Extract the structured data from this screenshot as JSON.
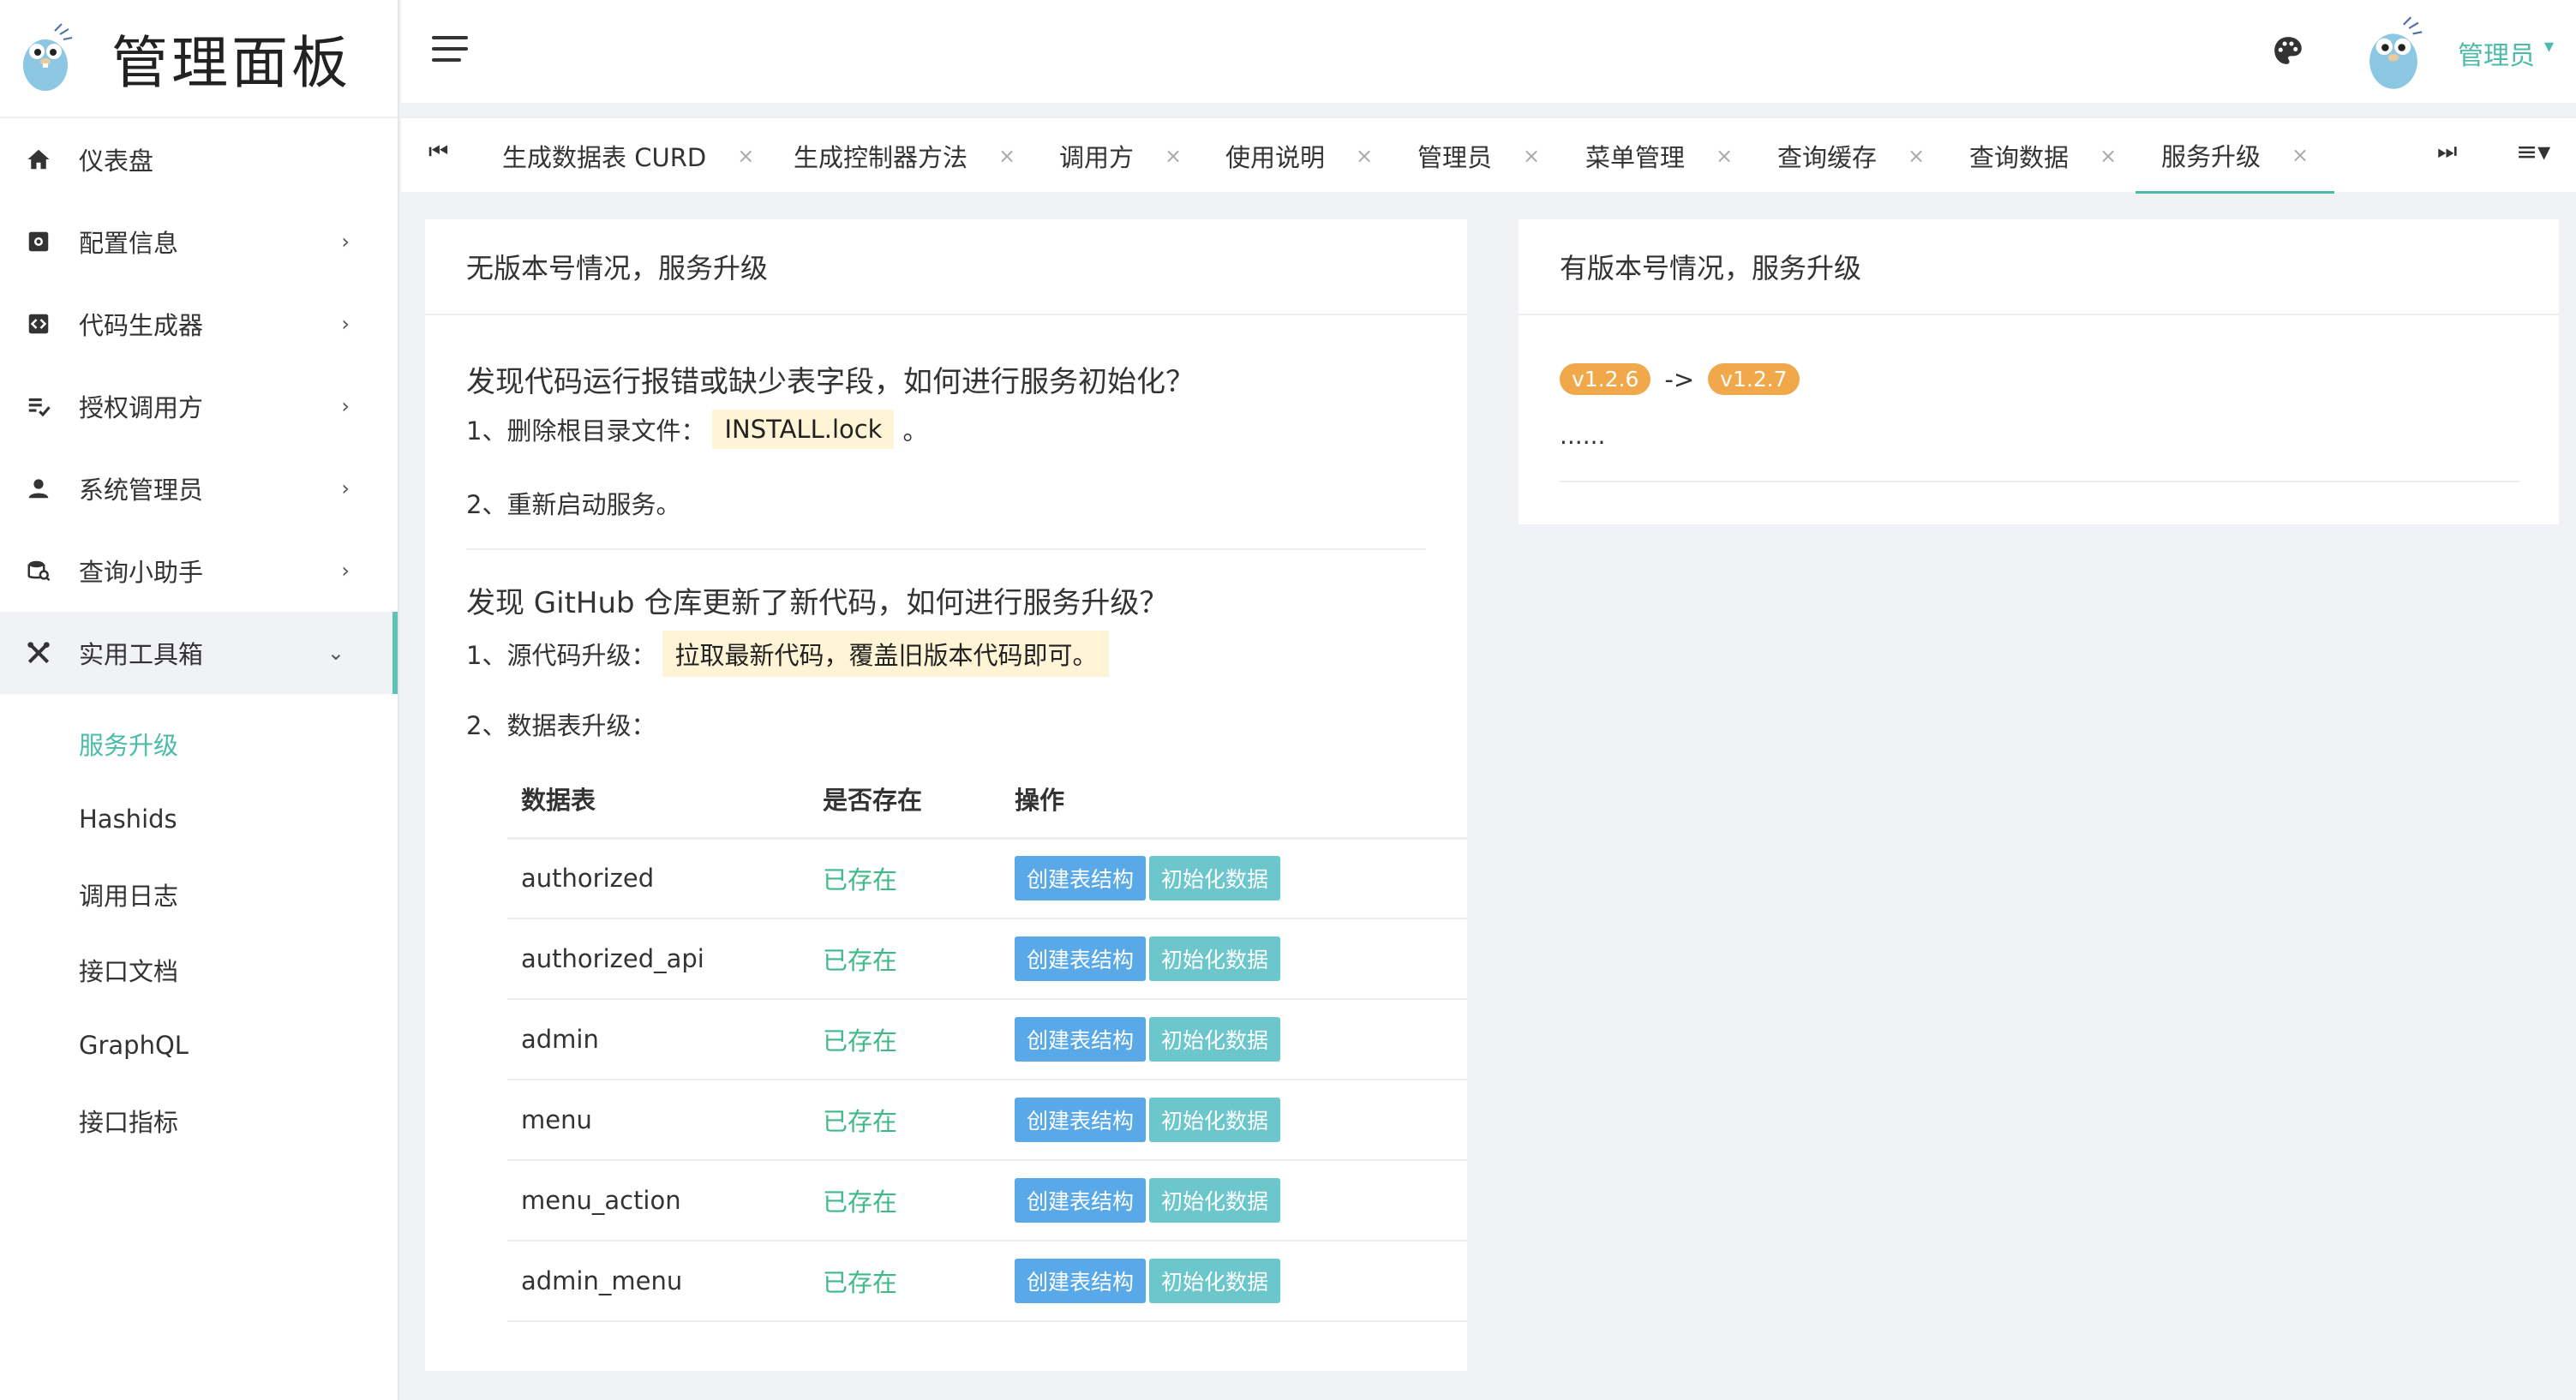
{
  "brand": {
    "title": "管理面板"
  },
  "sidebar": {
    "items": [
      {
        "label": "仪表盘",
        "icon": "home-icon"
      },
      {
        "label": "配置信息",
        "icon": "settings-icon"
      },
      {
        "label": "代码生成器",
        "icon": "code-icon"
      },
      {
        "label": "授权调用方",
        "icon": "list-check-icon"
      },
      {
        "label": "系统管理员",
        "icon": "user-icon"
      },
      {
        "label": "查询小助手",
        "icon": "database-search-icon"
      },
      {
        "label": "实用工具箱",
        "icon": "tools-icon"
      }
    ],
    "submenu": [
      "服务升级",
      "Hashids",
      "调用日志",
      "接口文档",
      "GraphQL",
      "接口指标"
    ]
  },
  "header": {
    "user": "管理员"
  },
  "tabs": [
    "生成数据表 CURD",
    "生成控制器方法",
    "调用方",
    "使用说明",
    "管理员",
    "菜单管理",
    "查询缓存",
    "查询数据",
    "服务升级"
  ],
  "card1": {
    "title": "无版本号情况，服务升级",
    "q1": "发现代码运行报错或缺少表字段，如何进行服务初始化？",
    "q1_step1": "1、删除根目录文件：",
    "q1_file": "INSTALL.lock",
    "q1_step1_end": "。",
    "q1_step2": "2、重新启动服务。",
    "q2": "发现 GitHub 仓库更新了新代码，如何进行服务升级？",
    "q2_step1": "1、源代码升级：",
    "q2_hl": "拉取最新代码，覆盖旧版本代码即可。",
    "q2_step2": "2、数据表升级：",
    "table": {
      "headers": [
        "数据表",
        "是否存在",
        "操作"
      ],
      "rows": [
        {
          "name": "authorized",
          "status": "已存在"
        },
        {
          "name": "authorized_api",
          "status": "已存在"
        },
        {
          "name": "admin",
          "status": "已存在"
        },
        {
          "name": "menu",
          "status": "已存在"
        },
        {
          "name": "menu_action",
          "status": "已存在"
        },
        {
          "name": "admin_menu",
          "status": "已存在"
        }
      ],
      "btn_create": "创建表结构",
      "btn_init": "初始化数据"
    }
  },
  "card2": {
    "title": "有版本号情况，服务升级",
    "from": "v1.2.6",
    "arrow": "->",
    "to": "v1.2.7",
    "ellipsis": "......"
  },
  "colors": {
    "accent": "#4cbba9",
    "blue_button": "#59a9e8",
    "teal_button": "#6cc7cd",
    "badge": "#f0a84a",
    "exists": "#3fb98a"
  }
}
